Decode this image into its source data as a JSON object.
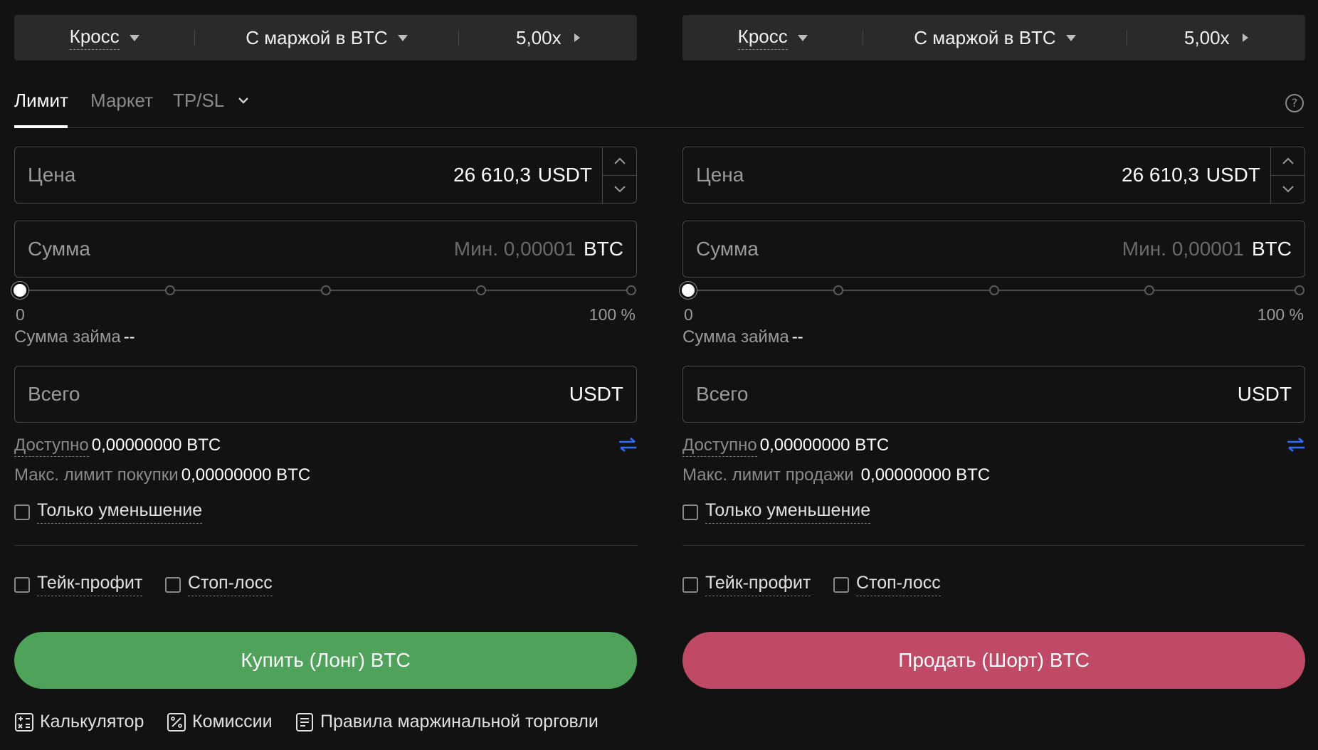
{
  "colors": {
    "background": "#121212",
    "buy": "#4ea25a",
    "sell": "#c04a65",
    "accent": "#2f6bff"
  },
  "tabs": [
    {
      "label": "Лимит",
      "active": true
    },
    {
      "label": "Маркет",
      "active": false
    },
    {
      "label": "TP/SL",
      "active": false,
      "icon": "chevron-down-icon"
    }
  ],
  "help_icon_glyph": "?",
  "left": {
    "margin_mode": "Кросс",
    "margin_currency": "С маржой в BTC",
    "leverage": "5,00x",
    "price_label": "Цена",
    "price_value": "26 610,3",
    "price_unit": "USDT",
    "amount_label": "Сумма",
    "amount_placeholder": "Мин. 0,00001",
    "amount_unit": "BTC",
    "slider_min": "0",
    "slider_max": "100 %",
    "slider_value_percent": 0,
    "loan_label": "Сумма займа",
    "loan_value": "--",
    "total_label": "Всего",
    "total_unit": "USDT",
    "available_label": "Доступно",
    "available_value": "0,00000000 BTC",
    "max_label": "Макс. лимит покупки",
    "max_value": "0,00000000 BTC",
    "reduce_only": "Только уменьшение",
    "take_profit": "Тейк-профит",
    "stop_loss": "Стоп-лосс",
    "action": "Купить (Лонг) BTC"
  },
  "right": {
    "margin_mode": "Кросс",
    "margin_currency": "С маржой в BTC",
    "leverage": "5,00x",
    "price_label": "Цена",
    "price_value": "26 610,3",
    "price_unit": "USDT",
    "amount_label": "Сумма",
    "amount_placeholder": "Мин. 0,00001",
    "amount_unit": "BTC",
    "slider_min": "0",
    "slider_max": "100 %",
    "slider_value_percent": 0,
    "loan_label": "Сумма займа",
    "loan_value": "--",
    "total_label": "Всего",
    "total_unit": "USDT",
    "available_label": "Доступно",
    "available_value": "0,00000000 BTC",
    "max_label": "Макс. лимит продажи",
    "max_value": "0,00000000 BTC",
    "reduce_only": "Только уменьшение",
    "take_profit": "Тейк-профит",
    "stop_loss": "Стоп-лосс",
    "action": "Продать (Шорт) BTC"
  },
  "footer": {
    "calculator": "Калькулятор",
    "fees": "Комиссии",
    "rules": "Правила маржинальной торговли"
  }
}
